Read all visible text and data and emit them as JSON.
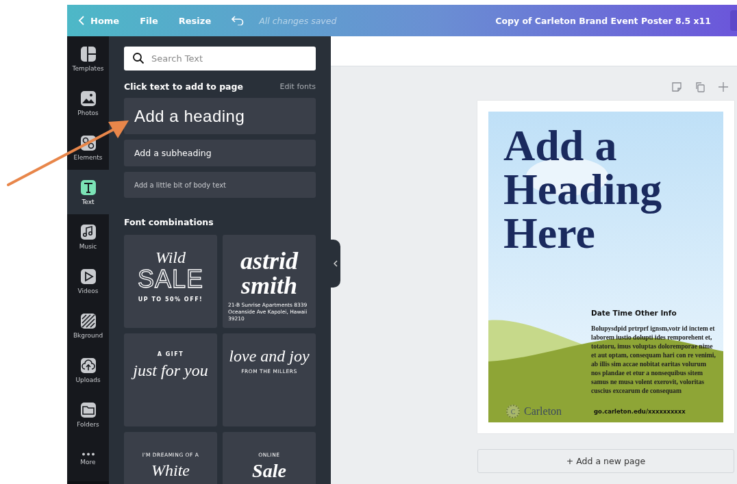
{
  "top_bar": {
    "back_label": "Home",
    "menu": [
      "File",
      "Resize"
    ],
    "status": "All changes saved",
    "document_title": "Copy of Carleton Brand Event Poster 8.5 x11"
  },
  "rail": [
    {
      "label": "Templates",
      "selected": false
    },
    {
      "label": "Photos",
      "selected": false
    },
    {
      "label": "Elements",
      "selected": false
    },
    {
      "label": "Text",
      "selected": true
    },
    {
      "label": "Music",
      "selected": false
    },
    {
      "label": "Videos",
      "selected": false
    },
    {
      "label": "Bkground",
      "selected": false
    },
    {
      "label": "Uploads",
      "selected": false
    },
    {
      "label": "Folders",
      "selected": false
    },
    {
      "label": "More",
      "selected": false
    }
  ],
  "panel": {
    "search_placeholder": "Search Text",
    "section_title": "Click text to add to page",
    "edit_fonts": "Edit fonts",
    "text_presets": [
      {
        "kind": "heading",
        "label": "Add a heading"
      },
      {
        "kind": "subheading",
        "label": "Add a subheading"
      },
      {
        "kind": "body",
        "label": "Add a little bit of body text"
      }
    ],
    "combinations_title": "Font combinations",
    "combinations": [
      {
        "lines": [
          {
            "kind": "script",
            "text": "Wild"
          },
          {
            "kind": "outline",
            "text": "SALE"
          },
          {
            "kind": "caps",
            "text": "UP TO 50% OFF!"
          }
        ]
      },
      {
        "lines": [
          {
            "kind": "serif-bold",
            "text": "astrid"
          },
          {
            "kind": "serif-bold",
            "text": "smith"
          },
          {
            "kind": "small",
            "text": "21-B Sunrise Apartments 8339 Oceanside Ave Kapolei, Hawaii 39210"
          }
        ]
      },
      {
        "lines": [
          {
            "kind": "caps",
            "text": "A GIFT"
          },
          {
            "kind": "script",
            "text": "just for you"
          }
        ]
      },
      {
        "lines": [
          {
            "kind": "script",
            "text": "love and joy"
          },
          {
            "kind": "tiny",
            "text": "FROM THE MILLERS"
          }
        ]
      },
      {
        "lines": [
          {
            "kind": "tiny",
            "text": "I'M DREAMING OF A"
          },
          {
            "kind": "script",
            "text": "White"
          }
        ]
      },
      {
        "lines": [
          {
            "kind": "tiny",
            "text": "ONLINE"
          },
          {
            "kind": "serif-bold",
            "text": "Sale"
          }
        ]
      }
    ]
  },
  "poster": {
    "heading": [
      "Add a",
      "Heading",
      "Here"
    ],
    "info_title": "Date Time Other Info",
    "body": "Bolupysdpid prtrprf ignsm,votr id inctem et laborem iustio dolupti ides remporehent et, totatoru, imus voluptas doloremporae nime et aut optam, consequam hari con re venimi, ab illis sim accae nobitat earitas volurum nos plandae et etur a nonsequibus sitem samus ne musa volent exerovit, voloritas cuscius excearum de consequam",
    "logo_mark": "C",
    "logo_text": "Carleton",
    "url": "go.carleton.edu/xxxxxxxxxx"
  },
  "add_page": "+ Add a new page"
}
